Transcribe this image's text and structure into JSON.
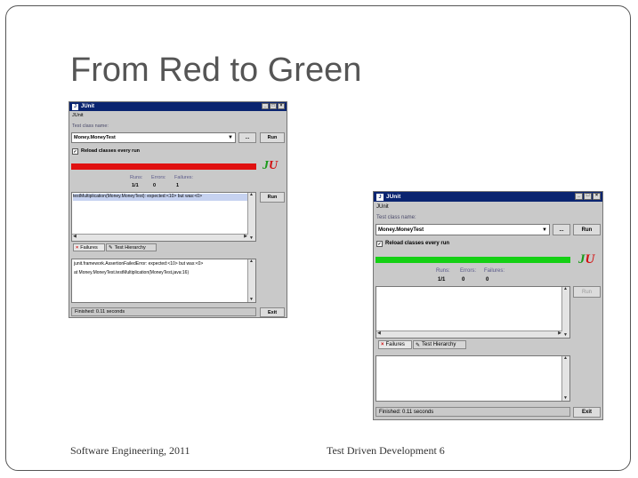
{
  "slide": {
    "title": "From Red to Green",
    "footer_left": "Software Engineering,   2011",
    "footer_mid": "Test Driven Development   6"
  },
  "colors": {
    "fail_bar": "#e01010",
    "pass_bar": "#14d014",
    "titlebar": "#0a2470"
  },
  "left_window": {
    "title": "JUnit",
    "menu": "JUnit",
    "test_class_label": "Test class name:",
    "test_class_value": "Money.MoneyTest",
    "browse_label": "...",
    "run_label": "Run",
    "reload_label": "Reload classes every run",
    "reload_checked": true,
    "bar_state": "fail",
    "runs_label": "Runs:",
    "runs_value": "1/1",
    "errors_label": "Errors:",
    "errors_value": "0",
    "failures_label": "Failures:",
    "failures_value": "1",
    "failure_item": "testMultiplication(Money.MoneyTest): expected:<10> but was:<0>",
    "run_again_label": "Run",
    "tab_failures": "Failures",
    "tab_hierarchy": "Test Hierarchy",
    "trace_line1": "junit.framework.AssertionFailedError: expected:<10> but was:<0>",
    "trace_line2": "at Money.MoneyTest.testMultiplication(MoneyTest.java:16)",
    "status": "Finished: 0.11 seconds",
    "exit_label": "Exit"
  },
  "right_window": {
    "title": "JUnit",
    "menu": "JUnit",
    "test_class_label": "Test class name:",
    "test_class_value": "Money.MoneyTest",
    "browse_label": "...",
    "run_label": "Run",
    "reload_label": "Reload classes every run",
    "reload_checked": true,
    "bar_state": "pass",
    "runs_label": "Runs:",
    "runs_value": "1/1",
    "errors_label": "Errors:",
    "errors_value": "0",
    "failures_label": "Failures:",
    "failures_value": "0",
    "run_again_label": "Run",
    "tab_failures": "Failures",
    "tab_hierarchy": "Test Hierarchy",
    "status": "Finished: 0.11 seconds",
    "exit_label": "Exit"
  }
}
